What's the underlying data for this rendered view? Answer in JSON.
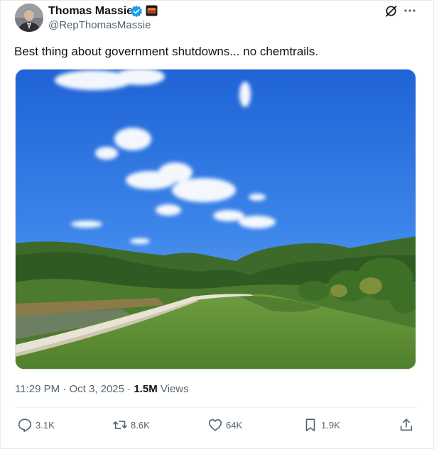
{
  "author": {
    "name": "Thomas Massie",
    "handle": "@RepThomasMassie"
  },
  "tweet": {
    "text": "Best thing about government shutdowns... no chemtrails.",
    "time": "11:29 PM",
    "separator": "·",
    "date": "Oct 3, 2025",
    "views_count": "1.5M",
    "views_label": "Views"
  },
  "actions": {
    "replies": "3.1K",
    "reposts": "8.6K",
    "likes": "64K",
    "bookmarks": "1.9K"
  },
  "colors": {
    "text": "#0f1419",
    "secondary": "#536471",
    "verified_blue": "#1d9bf0",
    "sky": "#2a74e3",
    "grass": "#5f8f35"
  },
  "icons": {
    "verified": "verified-badge-icon",
    "affiliation": "flag-icon",
    "grok": "grok-icon",
    "more": "more-icon",
    "reply": "reply-icon",
    "repost": "repost-icon",
    "like": "heart-icon",
    "bookmark": "bookmark-icon",
    "share": "share-icon"
  }
}
